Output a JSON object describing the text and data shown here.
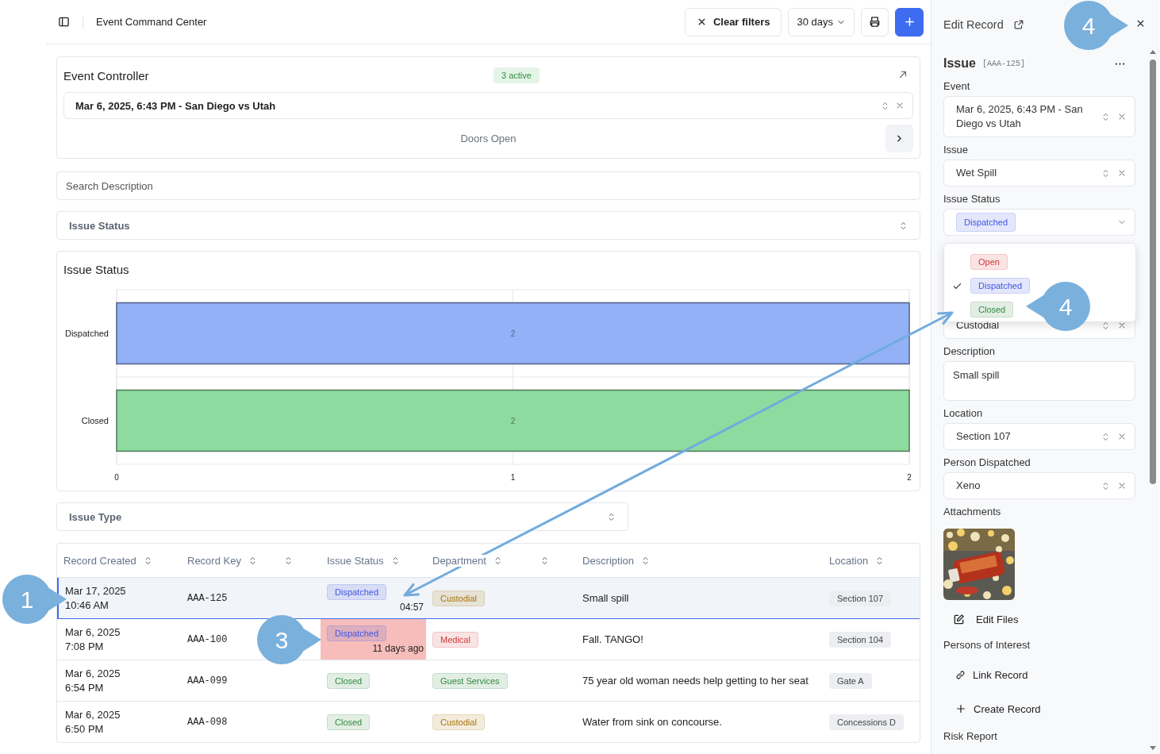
{
  "header": {
    "title": "Event Command Center",
    "clear_button": "Clear filters",
    "range_button": "30 days"
  },
  "event_controller": {
    "title": "Event Controller",
    "badge": "3 active",
    "event": "Mar 6, 2025, 6:43 PM - San Diego vs Utah",
    "phase": "Doors Open"
  },
  "search": {
    "placeholder": "Search Description"
  },
  "status_filter": {
    "placeholder": "Issue Status"
  },
  "status_chart": {
    "chart_data": {
      "type": "bar",
      "orientation": "horizontal",
      "title": "Issue Status",
      "categories": [
        "Dispatched",
        "Closed"
      ],
      "stacked": true,
      "series": [
        {
          "color": "#93b1f7",
          "values": [
            2,
            null
          ]
        },
        {
          "color": "#8edb9f",
          "values": [
            null,
            2
          ]
        }
      ],
      "xlim": [
        0,
        2
      ],
      "xticks": [
        0,
        1,
        2
      ],
      "data_labels": true
    }
  },
  "type_filter": {
    "placeholder": "Issue Type"
  },
  "table": {
    "columns": [
      {
        "label": "Record Created",
        "sortable": true
      },
      {
        "label": "Record Key",
        "sortable": true
      },
      {
        "sortable": true
      },
      {
        "label": "Issue Status",
        "sortable": true
      },
      {
        "label": "Department",
        "sortable": true
      },
      {
        "sortable": true
      },
      {
        "label": "Description",
        "sortable": true
      },
      {
        "label": "Location",
        "sortable": true
      }
    ],
    "rows": [
      {
        "date": "Mar 17, 2025",
        "time": "10:46 AM",
        "key": "AAA-125",
        "status": {
          "label": "Dispatched",
          "color": "#4056e0"
        },
        "timer": "04:57",
        "overdue": false,
        "department": {
          "label": "Custodial",
          "color": "#a87508"
        },
        "description": "Small spill",
        "location": "Section 107",
        "selected": true
      },
      {
        "date": "Mar 6, 2025",
        "time": "7:08 PM",
        "key": "AAA-100",
        "status": {
          "label": "Dispatched",
          "color": "#4056e0"
        },
        "timer": "11 days ago",
        "overdue": true,
        "department": {
          "label": "Medical",
          "color": "#d13838"
        },
        "description": "Fall. TANGO!",
        "location": "Section 104",
        "selected": false
      },
      {
        "date": "Mar 6, 2025",
        "time": "6:54 PM",
        "key": "AAA-099",
        "status": {
          "label": "Closed",
          "color": "#2f8a3f"
        },
        "overdue": false,
        "department": {
          "label": "Guest Services",
          "color": "#2f8a3f"
        },
        "description": "75 year old woman needs help getting to her seat",
        "location": "Gate A",
        "selected": false
      },
      {
        "date": "Mar 6, 2025",
        "time": "6:50 PM",
        "key": "AAA-098",
        "status": {
          "label": "Closed",
          "color": "#2f8a3f"
        },
        "overdue": false,
        "department": {
          "label": "Custodial",
          "color": "#a87508"
        },
        "description": "Water from sink on concourse.",
        "location": "Concessions D",
        "selected": false
      }
    ]
  },
  "panel": {
    "title": "Edit Record",
    "record_type": "Issue",
    "record_key": "[AAA-125]",
    "fields": [
      {
        "kind": "select",
        "label": "Event",
        "value": "Mar 6, 2025, 6:43 PM - San Diego vs Utah"
      },
      {
        "kind": "select",
        "label": "Issue",
        "value": "Wet Spill"
      },
      {
        "kind": "status",
        "label": "Issue Status",
        "value": {
          "label": "Dispatched",
          "color": "#4056e0"
        }
      },
      {
        "kind": "select",
        "value": "Custodial"
      },
      {
        "kind": "textarea",
        "label": "Description",
        "value": "Small spill"
      },
      {
        "kind": "select",
        "label": "Location",
        "value": "Section 107"
      },
      {
        "kind": "select",
        "label": "Person Dispatched",
        "value": "Xeno"
      }
    ],
    "status_menu": {
      "options": [
        {
          "label": "Open",
          "color": "#d13838",
          "selected": false
        },
        {
          "label": "Dispatched",
          "color": "#4056e0",
          "selected": true
        },
        {
          "label": "Closed",
          "color": "#2f8a3f",
          "selected": false
        }
      ]
    },
    "attachments": {
      "label": "Attachments",
      "edit_button": "Edit Files"
    },
    "persons": {
      "label": "Persons of Interest",
      "actions": [
        {
          "kind": "link",
          "label": "Link Record"
        },
        {
          "kind": "create",
          "label": "Create Record"
        }
      ]
    },
    "risk_report": "Risk Report"
  },
  "callouts": [
    {
      "number": "1",
      "kind": "rightward"
    },
    {
      "number": "3",
      "kind": "rightward"
    },
    {
      "number": "4",
      "kind": "rightward"
    },
    {
      "number": "4",
      "kind": "leftward"
    }
  ]
}
